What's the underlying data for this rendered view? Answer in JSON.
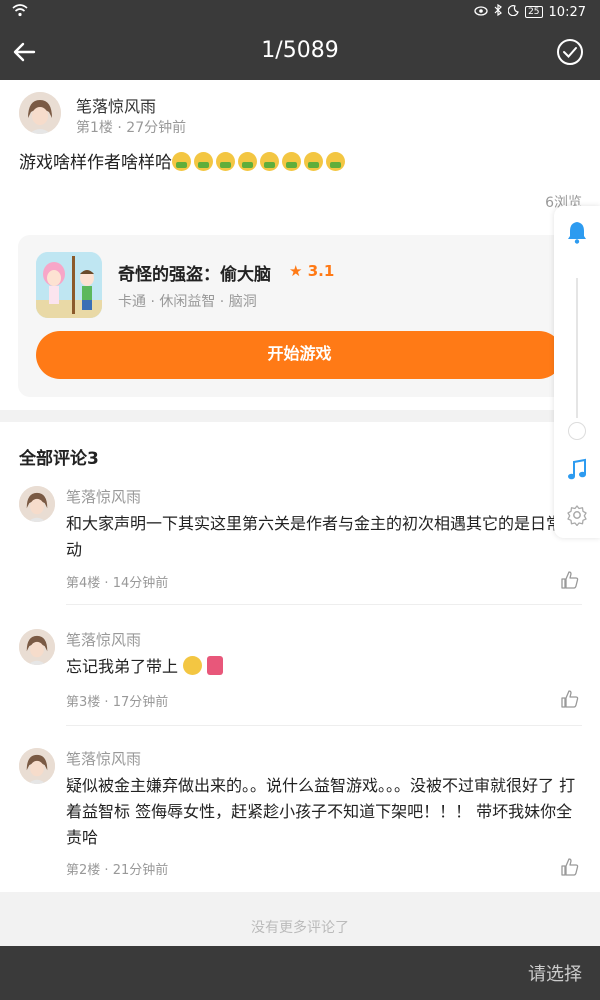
{
  "status_bar": {
    "time": "10:27",
    "battery": "25"
  },
  "header": {
    "title": "1/5089"
  },
  "post": {
    "author": "笔落惊风雨",
    "floor": "第1楼",
    "time": "27分钟前",
    "text": "游戏啥样作者啥样哈",
    "emoji_count": 8,
    "views": "6浏览"
  },
  "game": {
    "name": "奇怪的强盗：偷大脑",
    "rating": "3.1",
    "tags": "卡通 · 休闲益智 · 脑洞",
    "play_label": "开始游戏"
  },
  "comments": {
    "header": "全部评论3",
    "items": [
      {
        "author": "笔落惊风雨",
        "text": "和大家声明一下其实这里第六关是作者与金主的初次相遇其它的是日常活动",
        "floor": "第4楼",
        "time": "14分钟前"
      },
      {
        "author": "笔落惊风雨",
        "text": "忘记我弟了带上",
        "floor": "第3楼",
        "time": "17分钟前"
      },
      {
        "author": "笔落惊风雨",
        "text": "疑似被金主嫌弃做出来的。。说什么益智游戏。。。没被不过审就很好了 打着益智标 签侮辱女性，赶紧趁小孩子不知道下架吧！！！ 带坏我妹你全责哈",
        "floor": "第2楼",
        "time": "21分钟前"
      }
    ]
  },
  "footer": {
    "no_more": "没有更多评论了",
    "select_label": "请选择"
  },
  "colors": {
    "accent": "#ff7a16",
    "bar": "#3a3a3a",
    "panel_icon": "#2d9bf0"
  }
}
